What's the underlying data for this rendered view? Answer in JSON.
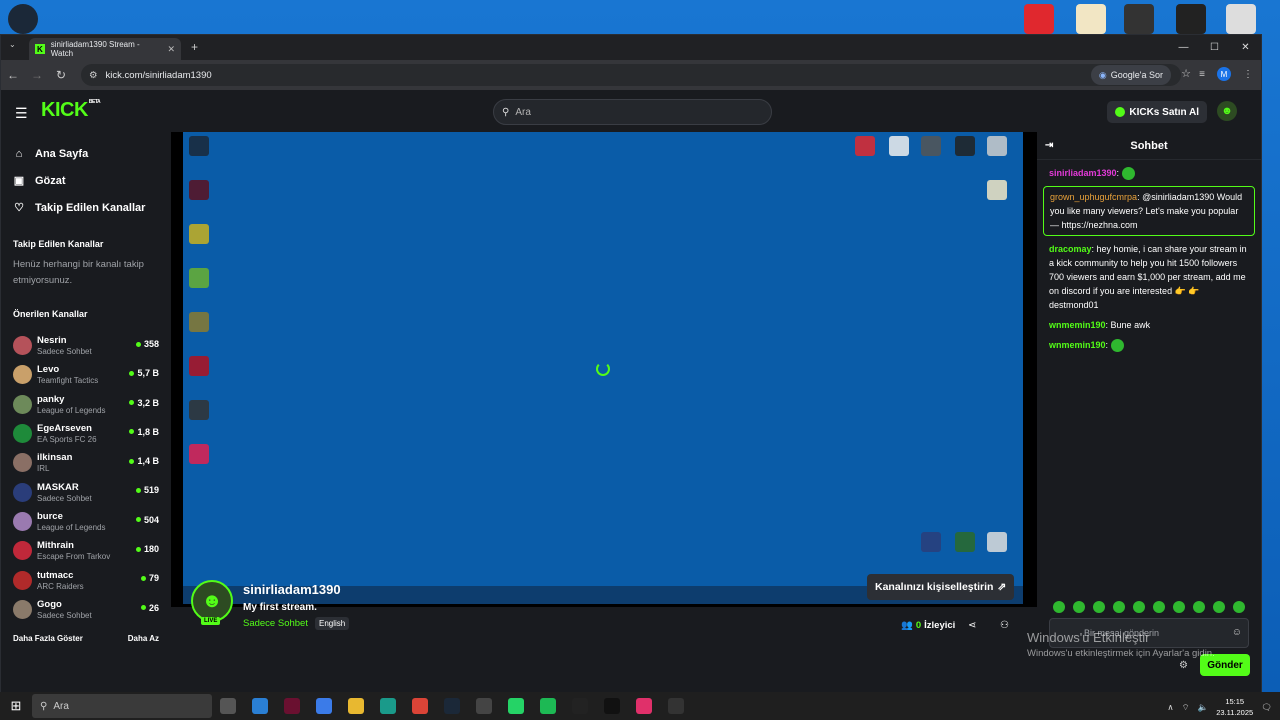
{
  "browser": {
    "tab_title": "sinirliadam1390 Stream - Watch",
    "url": "kick.com/sinirliadam1390",
    "google_sor": "Google'a Sor",
    "profile_initial": "M"
  },
  "site": {
    "logo": "KICK",
    "logo_badge": "BETA",
    "search_placeholder": "Ara",
    "kicks_button": "KICKs Satın Al"
  },
  "sidebar": {
    "nav": [
      {
        "label": "Ana Sayfa",
        "icon": "home-icon"
      },
      {
        "label": "Gözat",
        "icon": "browse-icon"
      },
      {
        "label": "Takip Edilen Kanallar",
        "icon": "heart-icon"
      }
    ],
    "followed_title": "Takip Edilen Kanallar",
    "followed_empty": "Henüz herhangi bir kanalı takip etmiyorsunuz.",
    "recommended_title": "Önerilen Kanallar",
    "channels": [
      {
        "name": "Nesrin",
        "category": "Sadece Sohbet",
        "viewers": "358",
        "color": "#b5525a"
      },
      {
        "name": "Levo",
        "category": "Teamfight Tactics",
        "viewers": "5,7 B",
        "color": "#c9a06a"
      },
      {
        "name": "panky",
        "category": "League of Legends",
        "viewers": "3,2 B",
        "color": "#6d8a5a"
      },
      {
        "name": "EgeArseven",
        "category": "EA Sports FC 26",
        "viewers": "1,8 B",
        "color": "#1e8a3a"
      },
      {
        "name": "ilkinsan",
        "category": "IRL",
        "viewers": "1,4 B",
        "color": "#8a6f65"
      },
      {
        "name": "MASKAR",
        "category": "Sadece Sohbet",
        "viewers": "519",
        "color": "#2a3d7a"
      },
      {
        "name": "burce",
        "category": "League of Legends",
        "viewers": "504",
        "color": "#9a7ab0"
      },
      {
        "name": "Mithrain",
        "category": "Escape From Tarkov",
        "viewers": "180",
        "color": "#c0283a"
      },
      {
        "name": "tutmacc",
        "category": "ARC Raiders",
        "viewers": "79",
        "color": "#b02a2a"
      },
      {
        "name": "Gogo",
        "category": "Sadece Sohbet",
        "viewers": "26",
        "color": "#8a7a6a"
      }
    ],
    "show_more": "Daha Fazla Göster",
    "show_less": "Daha Az"
  },
  "stream": {
    "channel": "sinirliadam1390",
    "title": "My first stream.",
    "category": "Sadece Sohbet",
    "language": "English",
    "live_badge": "LIVE",
    "customize_button": "Kanalınızı kişiselleştirin",
    "viewer_count": "0",
    "viewer_label": "İzleyici"
  },
  "chat": {
    "title": "Sohbet",
    "messages": [
      {
        "user": "sinirliadam1390",
        "text": "",
        "user_color": "#e23ad8"
      },
      {
        "user": "grown_uphugufcmrpa",
        "text": "@sinirliadam1390 Would you like many viewers? Let's make you popular — https://nezhna.com",
        "user_color": "#e8a13a",
        "pinned": true
      },
      {
        "user": "dracomay",
        "text": "hey homie, i can share your stream in a kick community to help you hit 1500 followers 700 viewers and earn $1,000 per stream, add me on discord if you are interested 👉 👉 destmond01",
        "user_color": "#53fc18"
      },
      {
        "user": "wnmemin190",
        "text": "Bune awk",
        "user_color": "#53fc18"
      },
      {
        "user": "wnmemin190",
        "text": "",
        "user_color": "#53fc18"
      }
    ],
    "input_placeholder": "Bir mesaj gönderin",
    "send_button": "Gönder"
  },
  "watermark": {
    "line1": "Windows'u Etkinleştir",
    "line2": "Windows'u etkinleştirmek için Ayarlar'a gidin."
  },
  "taskbar": {
    "search": "Ara",
    "time": "15:15",
    "date": "23.11.2025"
  }
}
